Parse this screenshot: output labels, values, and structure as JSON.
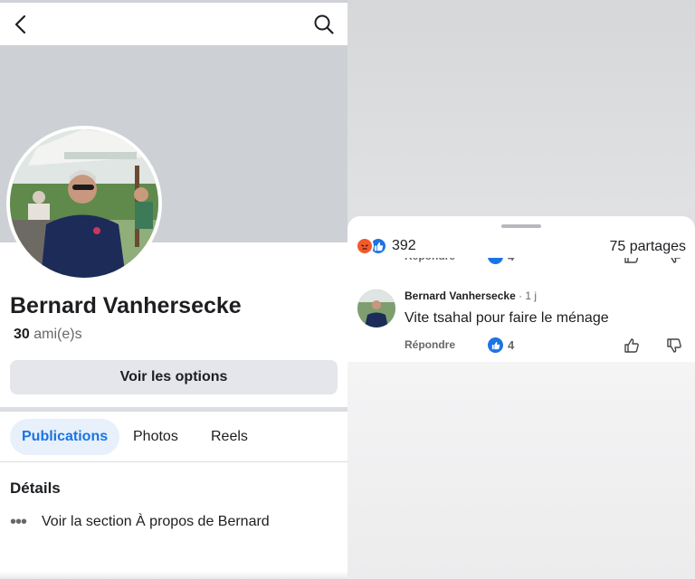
{
  "profile": {
    "name": "Bernard Vanhersecke",
    "friends_count": "30",
    "friends_label": "ami(e)s",
    "options_button": "Voir les options",
    "tabs": [
      {
        "label": "Publications"
      },
      {
        "label": "Photos"
      },
      {
        "label": "Reels"
      }
    ],
    "details_heading": "Détails",
    "about_link": "Voir la section À propos de Bernard"
  },
  "post": {
    "reaction_count": "392",
    "shares": "75 partages"
  },
  "comment": {
    "author": "Bernard Vanhersecke",
    "time": "· 1 j",
    "text": "Vite tsahal pour faire le ménage",
    "reply_label": "Répondre",
    "like_count": "4"
  },
  "colors": {
    "accent": "#1b74e4",
    "angry": "#f25a2b"
  }
}
